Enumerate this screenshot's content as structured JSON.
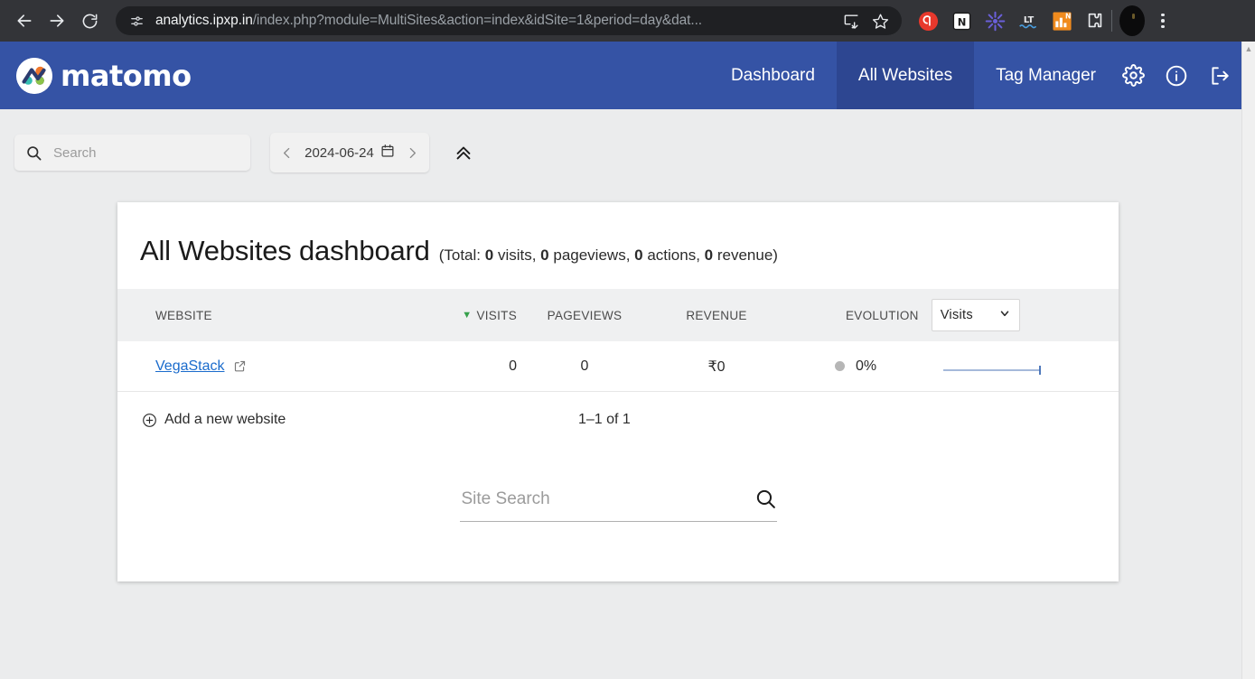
{
  "browser": {
    "back_icon": "arrow-left-icon",
    "forward_icon": "arrow-right-icon",
    "reload_icon": "reload-icon",
    "site_info_icon": "site-settings-icon",
    "url_host": "analytics.ipxp.in",
    "url_path": "/index.php?module=MultiSites&action=index&idSite=1&period=day&dat...",
    "url_full": "analytics.ipxp.in/index.php?module=MultiSites&action=index&idSite=1&period=day&dat...",
    "install_icon": "install-app-icon",
    "bookmark_icon": "star-icon",
    "extensions": [
      {
        "name": "ext-icon-red-circle",
        "label": "Q"
      },
      {
        "name": "ext-icon-notion",
        "label": "N"
      },
      {
        "name": "ext-icon-asterisk",
        "label": "*"
      },
      {
        "name": "ext-icon-languagetool",
        "label": "LT"
      },
      {
        "name": "ext-icon-orange-chart",
        "label": "N"
      },
      {
        "name": "ext-icon-puzzle",
        "label": ""
      }
    ],
    "profile_icon": "profile-avatar",
    "menu_icon": "kebab-menu-icon"
  },
  "header": {
    "logo_text": "matomo",
    "logo_icon": "matomo-logo-icon",
    "nav": [
      {
        "label": "Dashboard",
        "active": false
      },
      {
        "label": "All Websites",
        "active": true
      },
      {
        "label": "Tag Manager",
        "active": false
      }
    ],
    "icons": [
      {
        "name": "gear-icon"
      },
      {
        "name": "info-icon"
      },
      {
        "name": "sign-out-icon"
      }
    ],
    "brand_color": "#3553a5",
    "active_tab_color": "#2d4691"
  },
  "controls": {
    "search": {
      "placeholder": "Search",
      "value": "",
      "icon": "search-icon"
    },
    "period": {
      "prev_icon": "chevron-left-icon",
      "date": "2024-06-24",
      "calendar_icon": "calendar-icon",
      "next_icon": "chevron-right-icon"
    },
    "collapse_icon": "chevrons-up-icon"
  },
  "dashboard": {
    "title": "All Websites dashboard",
    "summary_prefix": "(Total: ",
    "summary_parts": [
      {
        "value": "0",
        "label": " visits, "
      },
      {
        "value": "0",
        "label": " pageviews, "
      },
      {
        "value": "0",
        "label": " actions, "
      },
      {
        "value": "0",
        "label": " revenue)"
      }
    ],
    "summary_full": "(Total: 0 visits, 0 pageviews, 0 actions, 0 revenue)",
    "columns": {
      "website": "WEBSITE",
      "visits": "VISITS",
      "pageviews": "PAGEVIEWS",
      "revenue": "REVENUE",
      "evolution": "EVOLUTION"
    },
    "sort_column": "VISITS",
    "sort_direction": "desc",
    "sort_arrow_color": "#35a04b",
    "evolution_select": {
      "value": "Visits",
      "chevron_icon": "chevron-down-icon"
    },
    "rows": [
      {
        "website": "VegaStack",
        "external_link_icon": "external-link-icon",
        "visits": "0",
        "pageviews": "0",
        "revenue": "₹0",
        "evolution_dot": "neutral-dot",
        "evolution": "0%",
        "sparkline": "flat-line"
      }
    ],
    "footer": {
      "add_website_label": "Add a new website",
      "add_website_icon": "plus-circle-icon",
      "pager": "1–1 of 1"
    },
    "site_search": {
      "placeholder": "Site Search",
      "value": "",
      "icon": "search-icon"
    }
  },
  "scrollbar": {
    "up_arrow_icon": "triangle-up-icon"
  }
}
